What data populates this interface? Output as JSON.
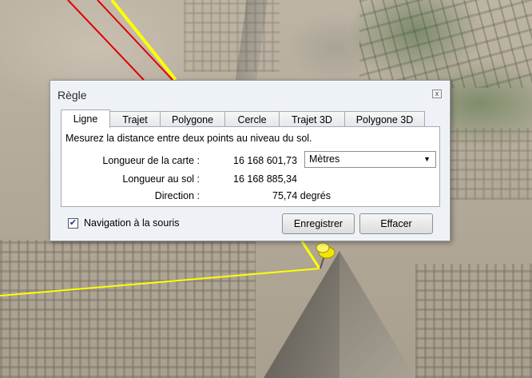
{
  "dialog": {
    "title": "Règle",
    "close_label": "x"
  },
  "tabs": [
    {
      "label": "Ligne",
      "active": true
    },
    {
      "label": "Trajet"
    },
    {
      "label": "Polygone"
    },
    {
      "label": "Cercle"
    },
    {
      "label": "Trajet 3D"
    },
    {
      "label": "Polygone 3D"
    }
  ],
  "panel": {
    "description": "Mesurez la distance entre deux points au niveau du sol.",
    "map_length_label": "Longueur de la carte :",
    "map_length_value": "16 168 601,73",
    "unit_selected": "Mètres",
    "ground_length_label": "Longueur au sol :",
    "ground_length_value": "16 168 885,34",
    "direction_label": "Direction :",
    "direction_value": "75,74 degrés"
  },
  "footer": {
    "mouse_nav_label": "Navigation à la souris",
    "mouse_nav_checked": true,
    "save_label": "Enregistrer",
    "clear_label": "Effacer"
  },
  "colors": {
    "measure_line": "#ffff00",
    "road_lines": "#e00000",
    "pin": "#f2e600"
  },
  "icons": {
    "pushpin": "pushpin-icon",
    "close": "close-icon",
    "dropdown": "chevron-down-icon",
    "check": "checkmark-icon"
  }
}
